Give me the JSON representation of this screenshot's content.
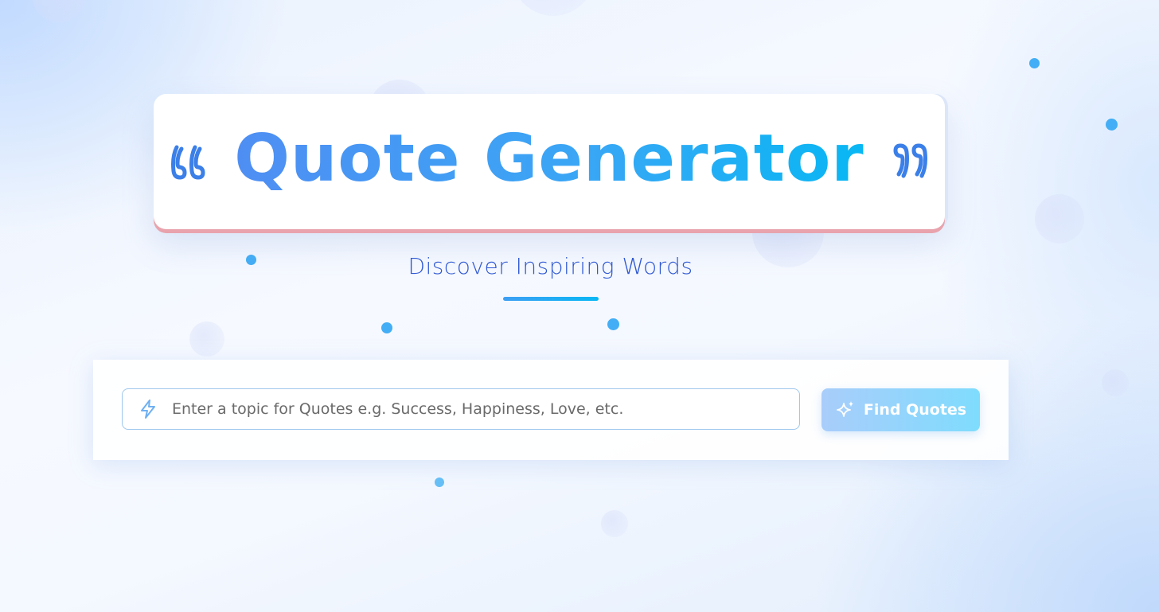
{
  "header": {
    "title": "Quote Generator",
    "subtitle": "Discover Inspiring Words",
    "left_icon": "quote-open-icon",
    "right_icon": "quote-close-icon"
  },
  "search": {
    "placeholder": "Enter a topic for Quotes e.g. Success, Happiness, Love, etc.",
    "value": "",
    "leading_icon": "lightning-bolt-icon"
  },
  "action": {
    "button_label": "Find Quotes",
    "button_icon": "sparkle-icon"
  },
  "colors": {
    "accent": "#3aa6f5",
    "accent_end": "#08b7f4",
    "subtitle": "#2f58d3",
    "dot": "#43aef5"
  }
}
